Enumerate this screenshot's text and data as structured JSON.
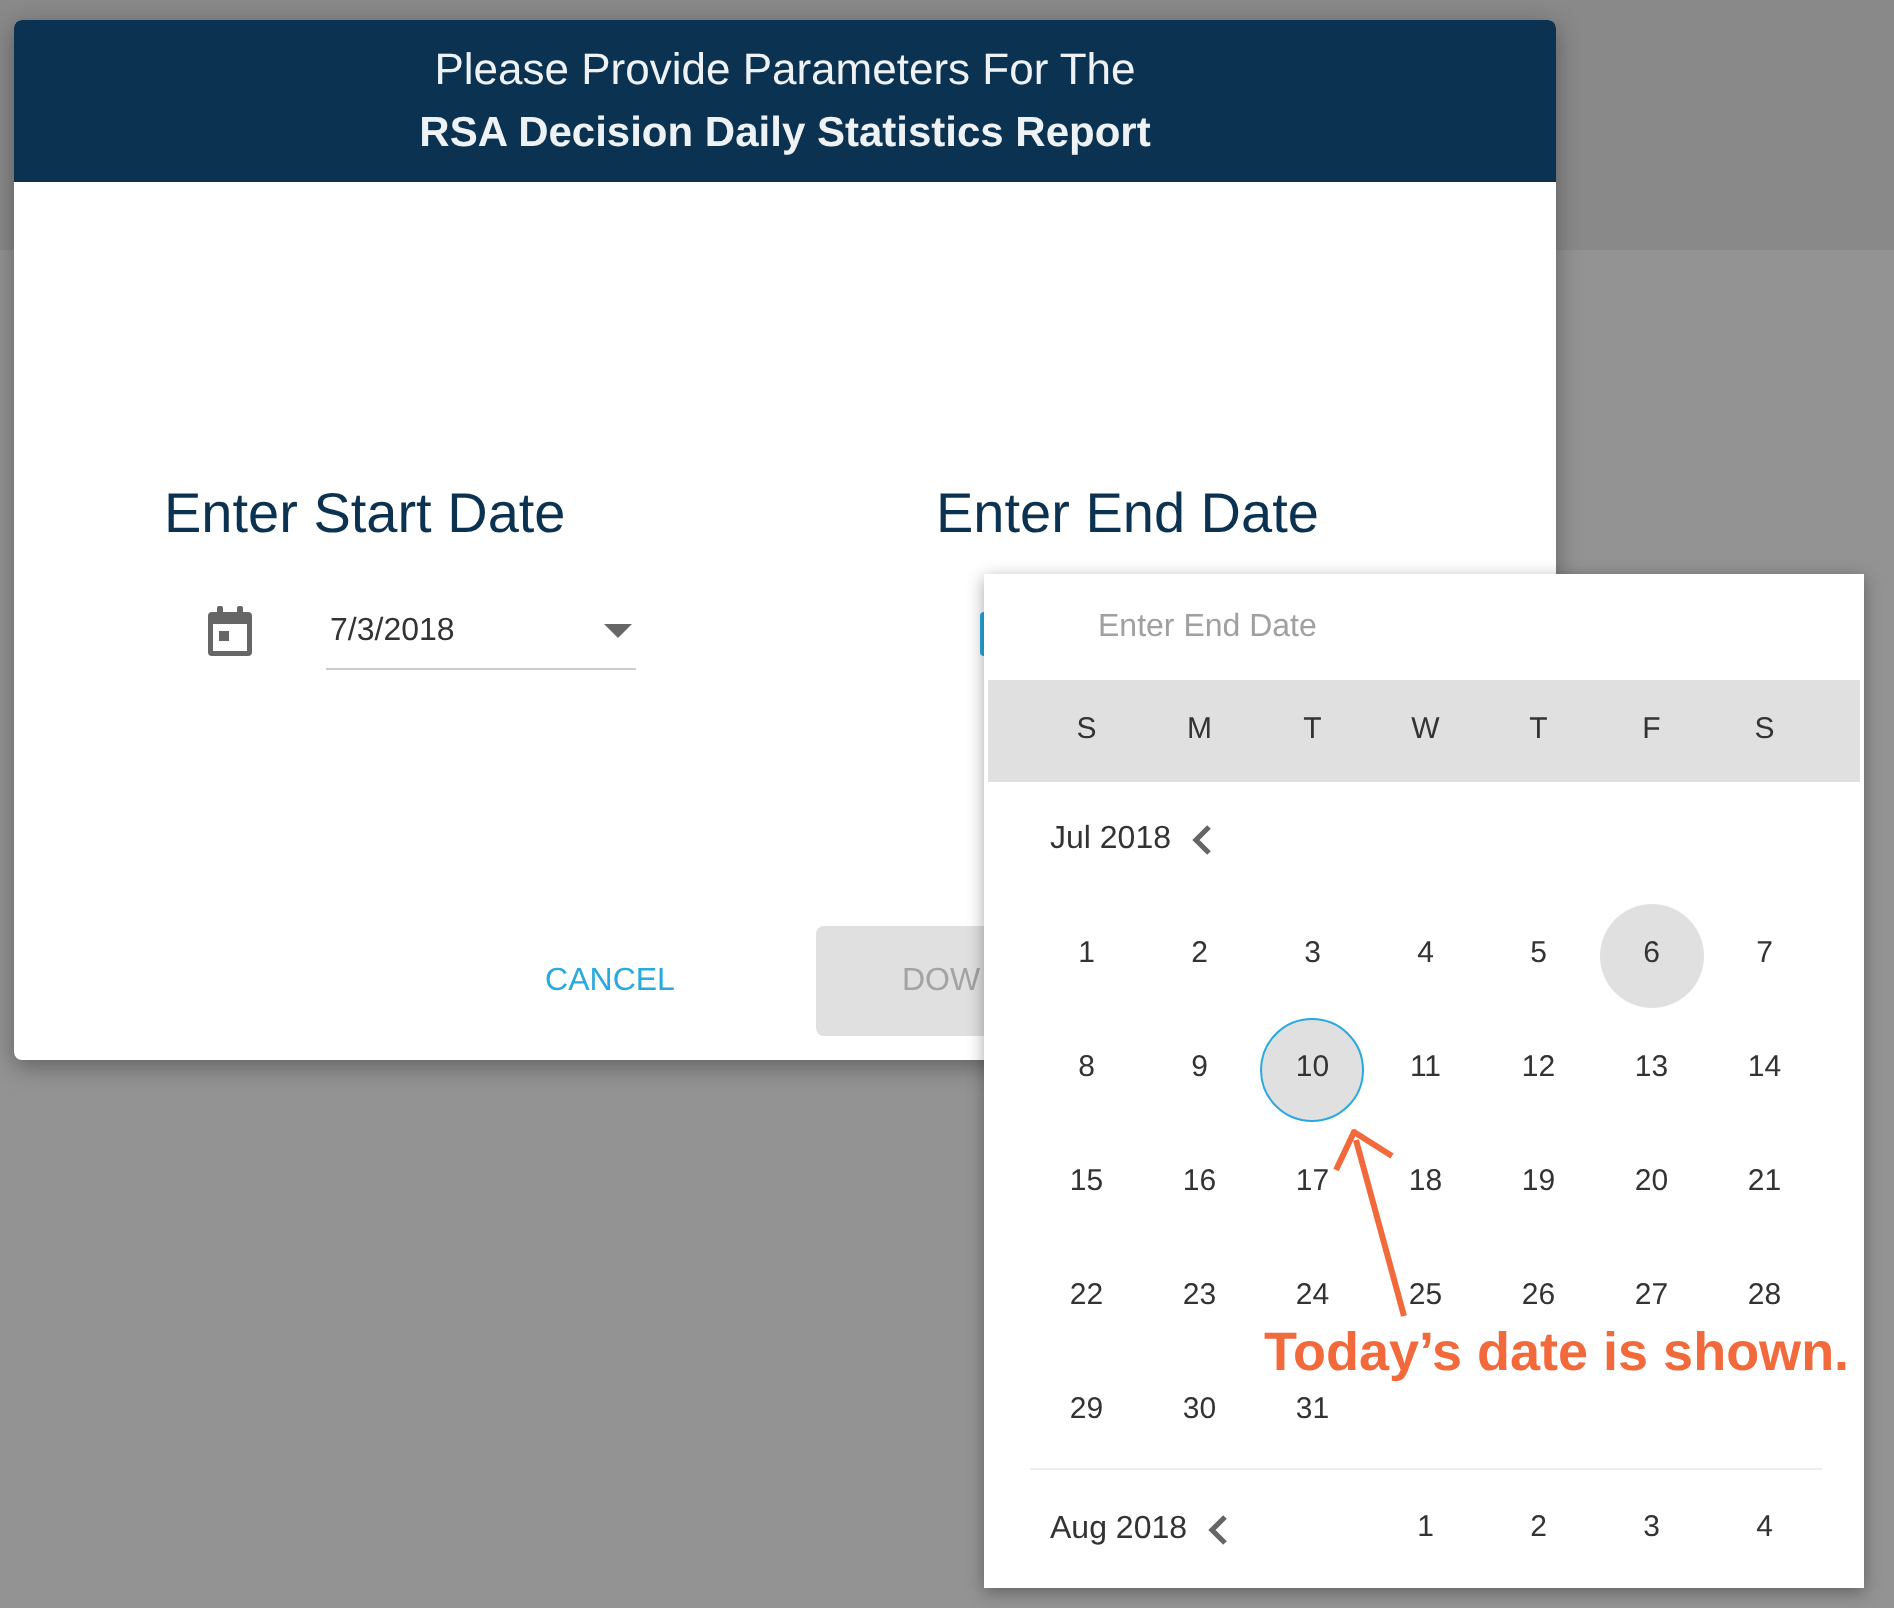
{
  "dialog": {
    "title": "Please Provide Parameters For The",
    "report_name": "RSA Decision Daily Statistics Report",
    "fields": [
      {
        "label": "Enter Start Date",
        "value": "7/3/2018",
        "focused": false
      },
      {
        "label": "Enter End Date",
        "focused": true
      }
    ],
    "buttons": [
      {
        "label": "CANCEL",
        "kind": "flat",
        "disabled": false
      },
      {
        "label": "DOW",
        "kind": "raised",
        "disabled": true
      }
    ]
  },
  "date_picker": {
    "placeholder": "Enter End Date",
    "weekdays": [
      "S",
      "M",
      "T",
      "W",
      "T",
      "F",
      "S"
    ],
    "months": [
      {
        "kind": "full",
        "label": "Jul 2018",
        "weeks": [
          [
            {
              "label": "1",
              "today": false,
              "highlighted": false
            },
            {
              "label": "2",
              "today": false,
              "highlighted": false
            },
            {
              "label": "3",
              "today": false,
              "highlighted": false
            },
            {
              "label": "4",
              "today": false,
              "highlighted": false
            },
            {
              "label": "5",
              "today": false,
              "highlighted": false
            },
            {
              "label": "6",
              "today": false,
              "highlighted": true
            },
            {
              "label": "7",
              "today": false,
              "highlighted": false
            }
          ],
          [
            {
              "label": "8",
              "today": false,
              "highlighted": false
            },
            {
              "label": "9",
              "today": false,
              "highlighted": false
            },
            {
              "label": "10",
              "today": true,
              "highlighted": true
            },
            {
              "label": "11",
              "today": false,
              "highlighted": false
            },
            {
              "label": "12",
              "today": false,
              "highlighted": false
            },
            {
              "label": "13",
              "today": false,
              "highlighted": false
            },
            {
              "label": "14",
              "today": false,
              "highlighted": false
            }
          ],
          [
            {
              "label": "15",
              "today": false,
              "highlighted": false
            },
            {
              "label": "16",
              "today": false,
              "highlighted": false
            },
            {
              "label": "17",
              "today": false,
              "highlighted": false
            },
            {
              "label": "18",
              "today": false,
              "highlighted": false
            },
            {
              "label": "19",
              "today": false,
              "highlighted": false
            },
            {
              "label": "20",
              "today": false,
              "highlighted": false
            },
            {
              "label": "21",
              "today": false,
              "highlighted": false
            }
          ],
          [
            {
              "label": "22",
              "today": false,
              "highlighted": false
            },
            {
              "label": "23",
              "today": false,
              "highlighted": false
            },
            {
              "label": "24",
              "today": false,
              "highlighted": false
            },
            {
              "label": "25",
              "today": false,
              "highlighted": false
            },
            {
              "label": "26",
              "today": false,
              "highlighted": false
            },
            {
              "label": "27",
              "today": false,
              "highlighted": false
            },
            {
              "label": "28",
              "today": false,
              "highlighted": false
            }
          ],
          [
            {
              "label": "29",
              "today": false,
              "highlighted": false
            },
            {
              "label": "30",
              "today": false,
              "highlighted": false
            },
            {
              "label": "31",
              "today": false,
              "highlighted": false
            }
          ]
        ]
      },
      {
        "kind": "preview",
        "label": "Aug 2018",
        "days": [
          {
            "label": "1",
            "today": false,
            "highlighted": false
          },
          {
            "label": "2",
            "today": false,
            "highlighted": false
          },
          {
            "label": "3",
            "today": false,
            "highlighted": false
          },
          {
            "label": "4",
            "today": false,
            "highlighted": false
          }
        ]
      }
    ]
  },
  "annotation": {
    "text": "Today’s date is shown."
  }
}
